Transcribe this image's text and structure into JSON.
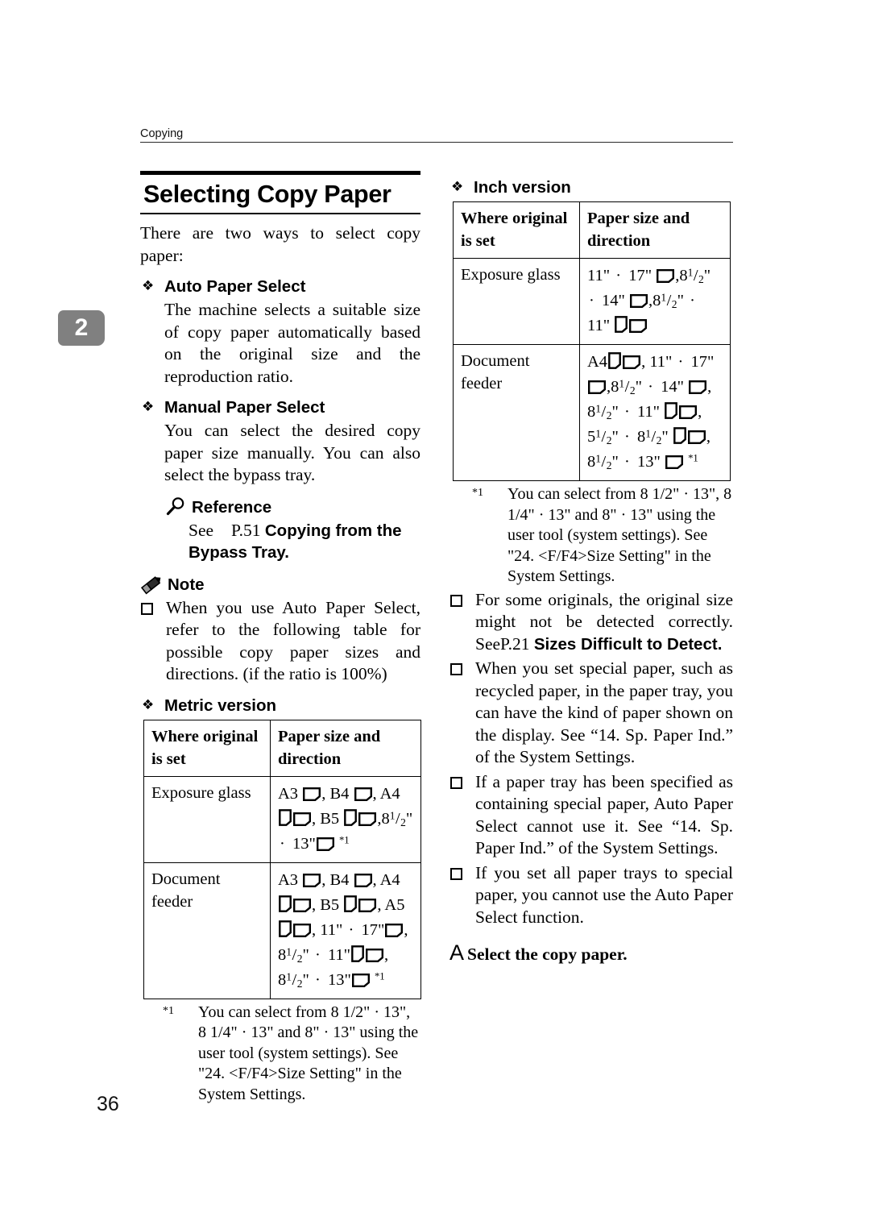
{
  "page": {
    "running_head": "Copying",
    "folio": "36",
    "chapter_tab": "2"
  },
  "section": {
    "title": "Selecting Copy Paper",
    "lead": "There are two ways to select copy paper:"
  },
  "icons": {
    "diamond": "❖",
    "checkbox": "checkbox-bullet",
    "magnifier": "magnifier-icon",
    "pencil": "pencil-icon",
    "portrait_paper": "paper-portrait-icon",
    "landscape_paper": "paper-landscape-icon"
  },
  "left_column": {
    "auto_paper": {
      "heading": "Auto Paper Select",
      "body": "The machine selects a suitable size of copy paper automatically based on the original size and the reproduction ratio."
    },
    "manual_paper": {
      "heading": "Manual Paper Select",
      "body": "You can select the desired copy paper size manually. You can also select the bypass tray."
    },
    "reference": {
      "heading": "Reference",
      "see": "See",
      "page_ref": "P.51",
      "target": "Copying from the Bypass Tray",
      "trailing": "."
    },
    "note": {
      "heading": "Note",
      "items": [
        "When you use Auto Paper Select, refer to the following table for possible copy paper sizes and directions. (if the ratio is 100%)"
      ]
    },
    "metric": {
      "heading": "Metric version",
      "columns": [
        "Where original is set",
        "Paper size and direction"
      ],
      "rows": [
        {
          "where": "Exposure glass",
          "sizes": "A3 ▭, B4 ▭, A4 ▭▭, B5 ▭▭, 8 1/2\" · 13\" ▭ *1"
        },
        {
          "where": "Document feeder",
          "sizes": "A3 ▭, B4 ▭, A4 ▭▭, B5 ▭▭, A5 ▭▭, 11\" · 17\" ▭, 8 1/2\" · 11\" ▭▭, 8 1/2\" · 13\" ▭ *1"
        }
      ],
      "footnote": {
        "mark": "*1",
        "text": "You can select from 8 1/2\" · 13\", 8 1/4\" · 13\" and 8\" · 13\" using the user tool (system settings). See \"24. <F/F4>Size Setting\" in the System Settings."
      }
    }
  },
  "right_column": {
    "inch": {
      "heading": "Inch version",
      "columns": [
        "Where original is set",
        "Paper size and direction"
      ],
      "rows": [
        {
          "where": "Exposure glass",
          "sizes": "11\" · 17\" ▭, 8 1/2\" · 14\" ▭, 8 1/2\" · 11\" ▭▭"
        },
        {
          "where": "Document feeder",
          "sizes": "A4 ▭▭, 11\" · 17\" ▭, 8 1/2\" · 14\" ▭, 8 1/2\" · 11\" ▭▭, 5 1/2\" · 8 1/2\" ▭▭, 8 1/2\" · 13\" ▭ *1"
        }
      ],
      "footnote": {
        "mark": "*1",
        "text": "You can select from 8 1/2\" · 13\", 8 1/4\" · 13\" and 8\" · 13\" using the user tool (system settings). See \"24. <F/F4>Size Setting\" in the System Settings."
      }
    },
    "notes": {
      "detect": {
        "lead": "For some originals, the original size might not be detected correctly. See",
        "page_ref": "P.21",
        "target": "Sizes Difficult to Detect",
        "trailing": "."
      },
      "special_paper": "When you set special paper, such as recycled paper, in the paper tray, you can have the kind of paper shown on the display. See “14. Sp. Paper Ind.” of the System Settings.",
      "tray_specified": "If a paper tray has been specified as containing special paper, Auto Paper Select cannot use it. See “14. Sp. Paper Ind.” of the System Settings.",
      "all_special": "If you set all paper trays to special paper, you cannot use the Auto Paper Select function."
    },
    "step": {
      "letter": "A",
      "text": "Select the copy paper."
    }
  }
}
